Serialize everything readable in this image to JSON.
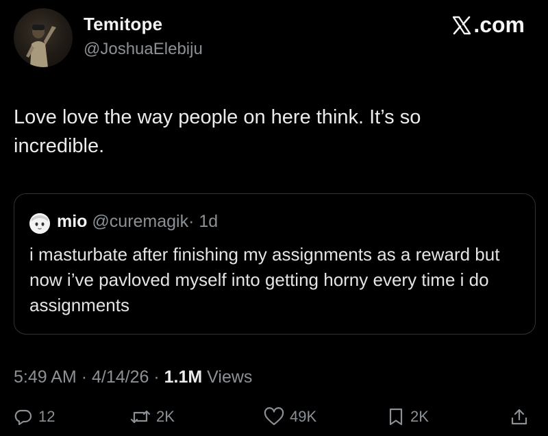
{
  "site": {
    "logo_text": ".com"
  },
  "author": {
    "display_name": "Temitope",
    "handle": "@JoshuaElebiju"
  },
  "tweet": {
    "text": "Love love the way people on here think. It’s so incredible."
  },
  "quote": {
    "name": "mio",
    "handle": "@curemagik",
    "separator": "·",
    "time": "1d",
    "text": "i masturbate after finishing my assignments as a reward but now i’ve pavloved myself into getting horny every time i do assignments"
  },
  "meta": {
    "time": "5:49 AM",
    "sep1": "·",
    "date": "4/14/26",
    "sep2": "·",
    "views_count": "1.1M",
    "views_label": "Views"
  },
  "actions": {
    "replies": "12",
    "reposts": "2K",
    "likes": "49K",
    "bookmarks": "2K"
  },
  "icons": {
    "reply": "reply-icon",
    "repost": "repost-icon",
    "like": "heart-icon",
    "bookmark": "bookmark-icon",
    "share": "share-icon"
  }
}
